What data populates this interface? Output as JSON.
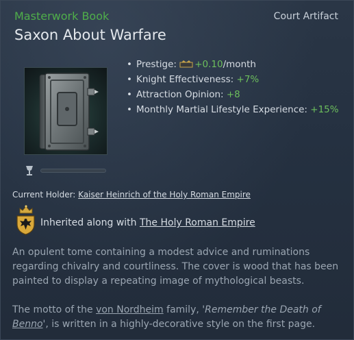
{
  "header": {
    "type_label": "Masterwork Book",
    "category_label": "Court Artifact",
    "title": "Saxon About Warfare"
  },
  "colors": {
    "type_label": "#4fae4a",
    "positive_value": "#6dbf5c",
    "description_text": "#9ba6b2"
  },
  "modifiers": [
    {
      "label": "Prestige: ",
      "icon": "prestige-icon",
      "value": "+0.10",
      "suffix": "/month"
    },
    {
      "label": "Knight Effectiveness: ",
      "value": "+7%"
    },
    {
      "label": "Attraction Opinion: ",
      "value": "+8"
    },
    {
      "label": "Monthly Martial Lifestyle Experience: ",
      "value": "+15%"
    }
  ],
  "artifact": {
    "image": "iron-bound-book",
    "rarity_icon": "goblet-icon",
    "durability_fraction": 1.0
  },
  "holder": {
    "label": "Current Holder: ",
    "name": "Kaiser Heinrich of the Holy Roman Empire"
  },
  "inheritance": {
    "crown_icon": "crown-icon",
    "coat_of_arms": "imperial-eagle-coa",
    "label": "Inherited along with ",
    "title_name": "The Holy Roman Empire"
  },
  "description": "An opulent tome containing a modest advice and ruminations regarding chivalry and courtliness. The cover is wood that has been painted to display a repeating image of mythological beasts.",
  "motto": {
    "prefix": "The motto of the ",
    "family": "von Nordheim",
    "mid": " family, ",
    "quote_start": "'Remember the Death of ",
    "quote_name": "Benno",
    "quote_end": "'",
    "suffix": ", is written in a highly-decorative style on the first page."
  }
}
